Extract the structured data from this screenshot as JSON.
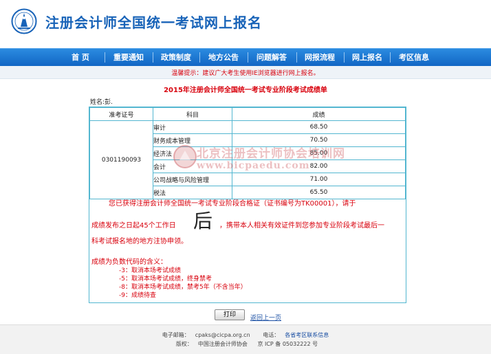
{
  "header": {
    "site_title": "注册会计师全国统一考试网上报名"
  },
  "nav": {
    "items": [
      "首 页",
      "重要通知",
      "政策制度",
      "地方公告",
      "问题解答",
      "网报流程",
      "网上报名",
      "考区信息"
    ]
  },
  "notice": "温馨提示：建议广大考生使用IE浏览器进行网上报名。",
  "report": {
    "title": "2015年注册会计师全国统一考试专业阶段考试成绩单",
    "name_label": "姓名:",
    "name_value": "彭.",
    "headers": {
      "candidate_id": "准考证号",
      "subject": "科目",
      "score": "成绩"
    },
    "candidate_id": "0301190093",
    "rows": [
      {
        "subject": "审计",
        "score": "68.50"
      },
      {
        "subject": "财务成本管理",
        "score": "70.50"
      },
      {
        "subject": "经济法",
        "score": "85.00"
      },
      {
        "subject": "会计",
        "score": "82.00"
      },
      {
        "subject": "公司战略与风险管理",
        "score": "71.00"
      },
      {
        "subject": "税法",
        "score": "65.50"
      }
    ],
    "cert_line1": "您已获得注册会计师全国统一考试专业阶段合格证（证书编号为TK00001），请于",
    "cert_line2a": "成绩发布之日起45个工作日",
    "cert_big": "后",
    "cert_line2b": "，携带本人相关有效证件到您参加专业阶段考试最后一",
    "cert_line3": "科考试报名地的地方注协申领。",
    "code_title": "成绩为负数代码的含义：",
    "codes": [
      "-3：取消本场考试成绩",
      "-5：取消本场考试成绩，终身禁考",
      "-8：取消本场考试成绩，禁考5年（不含当年）",
      "-9：成绩待查"
    ]
  },
  "watermark": {
    "cn": "北京注册会计师协会培训网",
    "en": "www.bicpaedu.com"
  },
  "actions": {
    "print": "打印",
    "back": "返回上一页"
  },
  "footer": {
    "email_label": "电子邮箱：",
    "email": "cpaks@cicpa.org.cn",
    "phone_label": "电话：",
    "phone_link": "各省考区联系信息",
    "copyright_label": "版权：",
    "copyright": "中国注册会计师协会",
    "icp": "京 ICP 备 05032222 号"
  },
  "colors": {
    "brand_blue": "#1863b8",
    "nav_blue": "#1a73cf",
    "alert_red": "#d8000c",
    "table_border": "#52b6d0"
  }
}
